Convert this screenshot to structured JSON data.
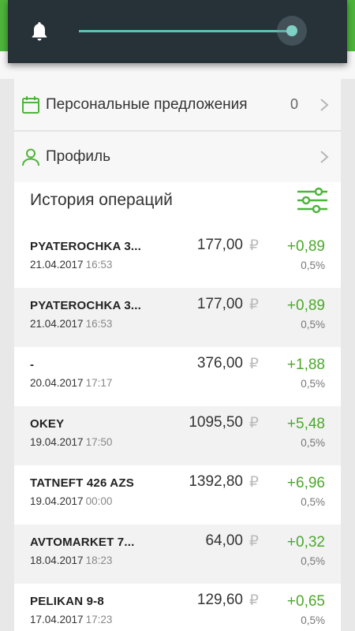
{
  "colors": {
    "accent_green": "#4db53a",
    "bonus_green": "#4ca82b",
    "volume_panel": "#263238",
    "slider_teal": "#5fc1b5"
  },
  "volume": {
    "icon": "bell-icon",
    "level": 1.0
  },
  "menu": {
    "offers": {
      "icon": "calendar-icon",
      "label": "Персональные предложения",
      "count": "0"
    },
    "profile": {
      "icon": "person-icon",
      "label": "Профиль"
    }
  },
  "history": {
    "title": "История операций",
    "filter_icon": "filter-sliders-icon",
    "currency": "₽",
    "items": [
      {
        "name": "PYATEROCHKA 3...",
        "date": "21.04.2017",
        "time": "16:53",
        "amount": "177,00",
        "bonus": "+0,89",
        "percent": "0,5%"
      },
      {
        "name": "PYATEROCHKA 3...",
        "date": "21.04.2017",
        "time": "16:53",
        "amount": "177,00",
        "bonus": "+0,89",
        "percent": "0,5%"
      },
      {
        "name": "-",
        "date": "20.04.2017",
        "time": "17:17",
        "amount": "376,00",
        "bonus": "+1,88",
        "percent": "0,5%"
      },
      {
        "name": "OKEY",
        "date": "19.04.2017",
        "time": "17:50",
        "amount": "1095,50",
        "bonus": "+5,48",
        "percent": "0,5%"
      },
      {
        "name": "TATNEFT 426 AZS",
        "date": "19.04.2017",
        "time": "00:00",
        "amount": "1392,80",
        "bonus": "+6,96",
        "percent": "0,5%"
      },
      {
        "name": "AVTOMARKET 7...",
        "date": "18.04.2017",
        "time": "18:23",
        "amount": "64,00",
        "bonus": "+0,32",
        "percent": "0,5%"
      },
      {
        "name": "PELIKAN 9-8",
        "date": "17.04.2017",
        "time": "17:23",
        "amount": "129,60",
        "bonus": "+0,65",
        "percent": "0,5%"
      }
    ]
  }
}
